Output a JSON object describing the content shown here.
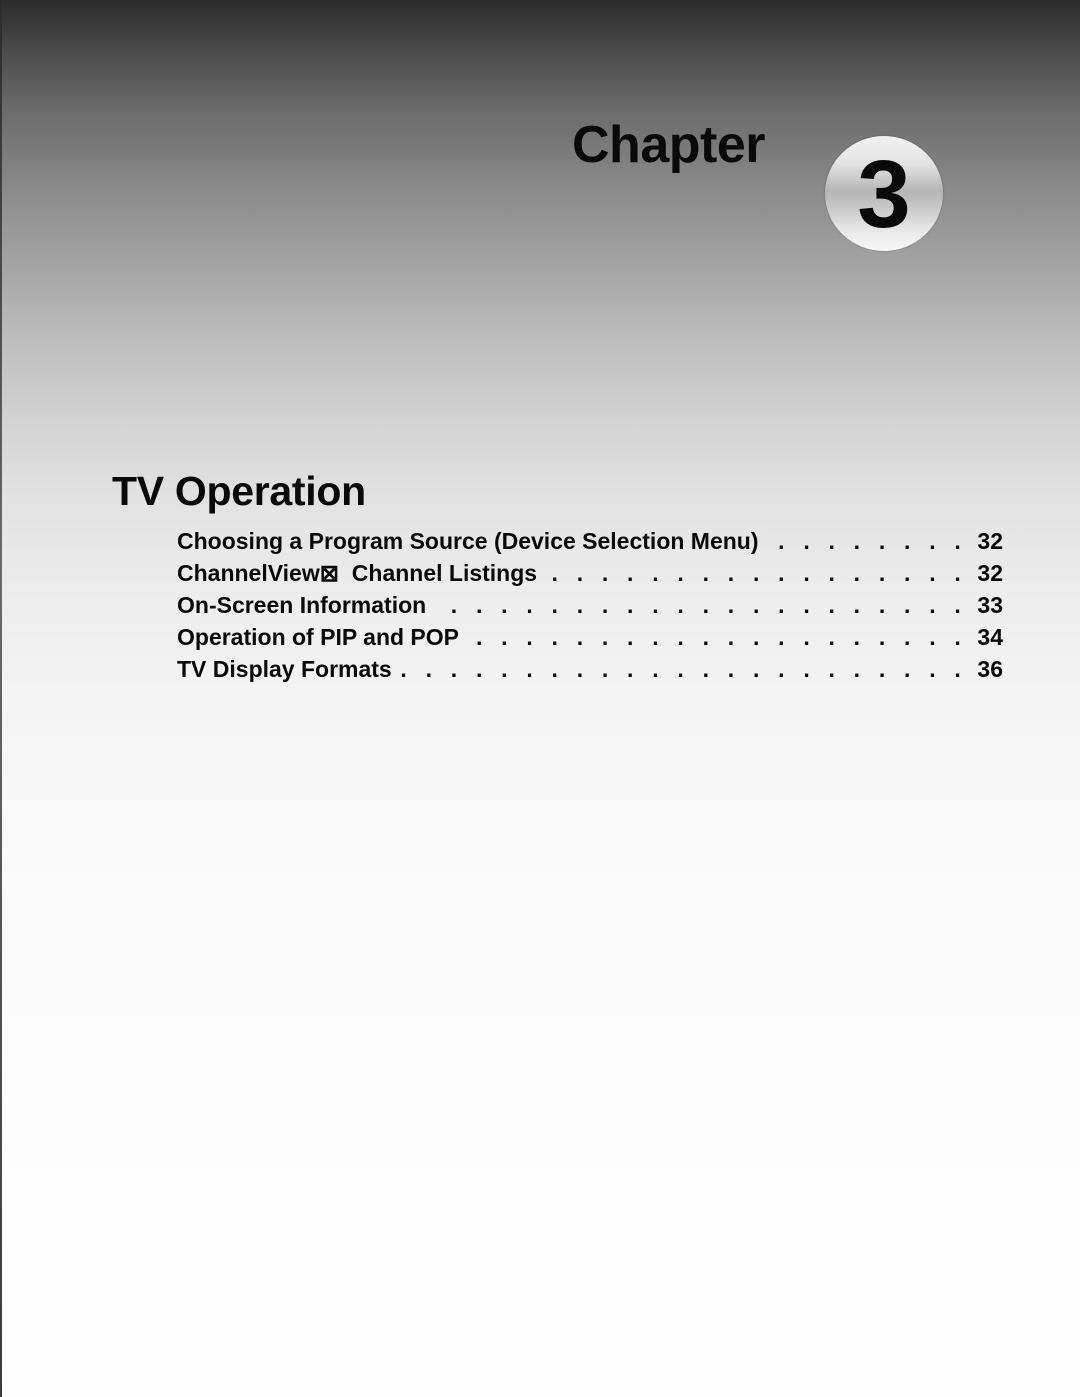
{
  "chapter": {
    "label": "Chapter",
    "number": "3"
  },
  "section": {
    "title": "TV Operation"
  },
  "toc": {
    "entries": [
      {
        "text": "Choosing a Program Source (Device Selection Menu)",
        "page": "32"
      },
      {
        "text": "ChannelView⊠  Channel Listings",
        "page": "32"
      },
      {
        "text": "On-Screen Information",
        "page": "33"
      },
      {
        "text": "Operation of PIP and POP",
        "page": "34"
      },
      {
        "text": "TV Display Formats",
        "page": "36"
      }
    ],
    "leader": ". . . . . . . . . . . . . . . . . . . . . . . . . . . . . . . . . . . . . . . . . . . . . . . . ."
  },
  "colors": {
    "background_top": "#2c2c2c",
    "background_bottom": "#fefefe",
    "text": "#0a0a0a"
  }
}
